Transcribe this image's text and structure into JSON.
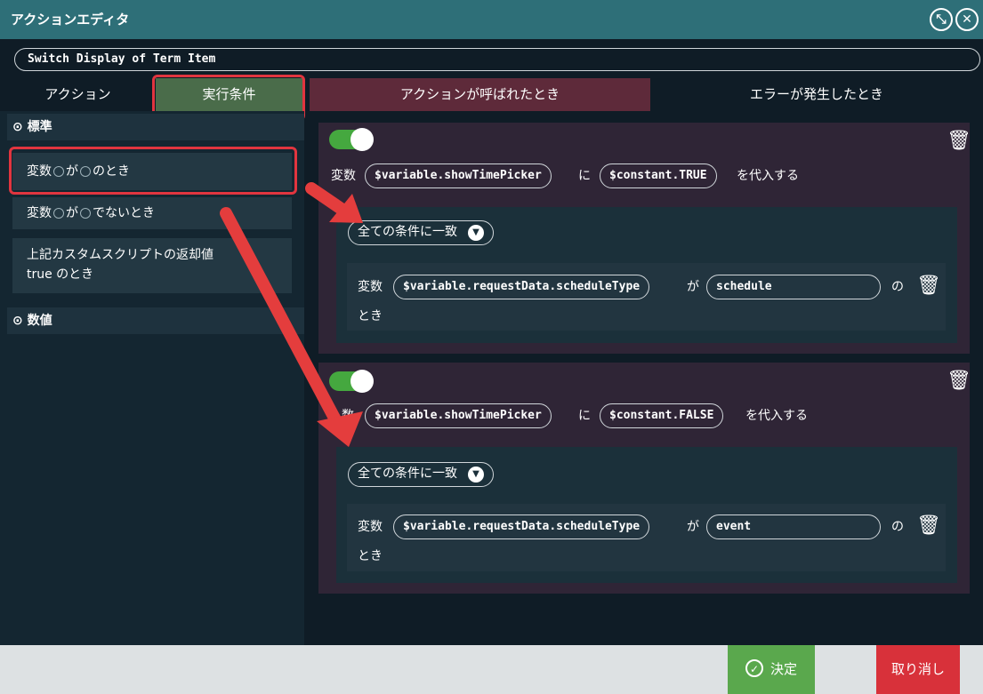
{
  "window": {
    "title": "アクションエディタ",
    "icons": [
      "collapse-icon",
      "close-icon"
    ]
  },
  "action_name": "Switch Display of Term Item",
  "tabs": [
    {
      "label": "アクション"
    },
    {
      "label": "実行条件"
    },
    {
      "label": "アクションが呼ばれたとき"
    },
    {
      "label": "エラーが発生したとき"
    }
  ],
  "sidebar": {
    "section_standard": "標準",
    "items": [
      {
        "part1": "変数",
        "part2": "が",
        "part3": "のとき"
      },
      {
        "part1": "変数",
        "part2": "が",
        "part3": "でないとき"
      },
      {
        "line1": "上記カスタムスクリプトの返却値",
        "line2": "true のとき"
      }
    ],
    "section_numeric": "数値"
  },
  "cards": [
    {
      "enabled": true,
      "prefix": "変数",
      "variable": "$variable.showTimePicker",
      "connector": "に",
      "value": "$constant.TRUE",
      "suffix": "を代入する",
      "match_mode": "全ての条件に一致",
      "condition": {
        "prefix": "変数",
        "variable": "$variable.requestData.scheduleType",
        "connector": "が",
        "value": "schedule",
        "suffix": "の",
        "tail": "とき"
      }
    },
    {
      "enabled": true,
      "prefix": "数",
      "variable": "$variable.showTimePicker",
      "connector": "に",
      "value": "$constant.FALSE",
      "suffix": "を代入する",
      "match_mode": "全ての条件に一致",
      "condition": {
        "prefix": "変数",
        "variable": "$variable.requestData.scheduleType",
        "connector": "が",
        "value": "event",
        "suffix": "の",
        "tail": "とき"
      }
    }
  ],
  "footer": {
    "ok_label": "決定",
    "cancel_label": "取り消し"
  },
  "colors": {
    "accent_teal": "#2e6f78",
    "ok_green": "#5aa84d",
    "cancel_red": "#d8313a",
    "highlight_red": "#e1353f",
    "tab_active_green": "#4a6c4a",
    "tab_event_maroon": "#5e2a3a"
  }
}
